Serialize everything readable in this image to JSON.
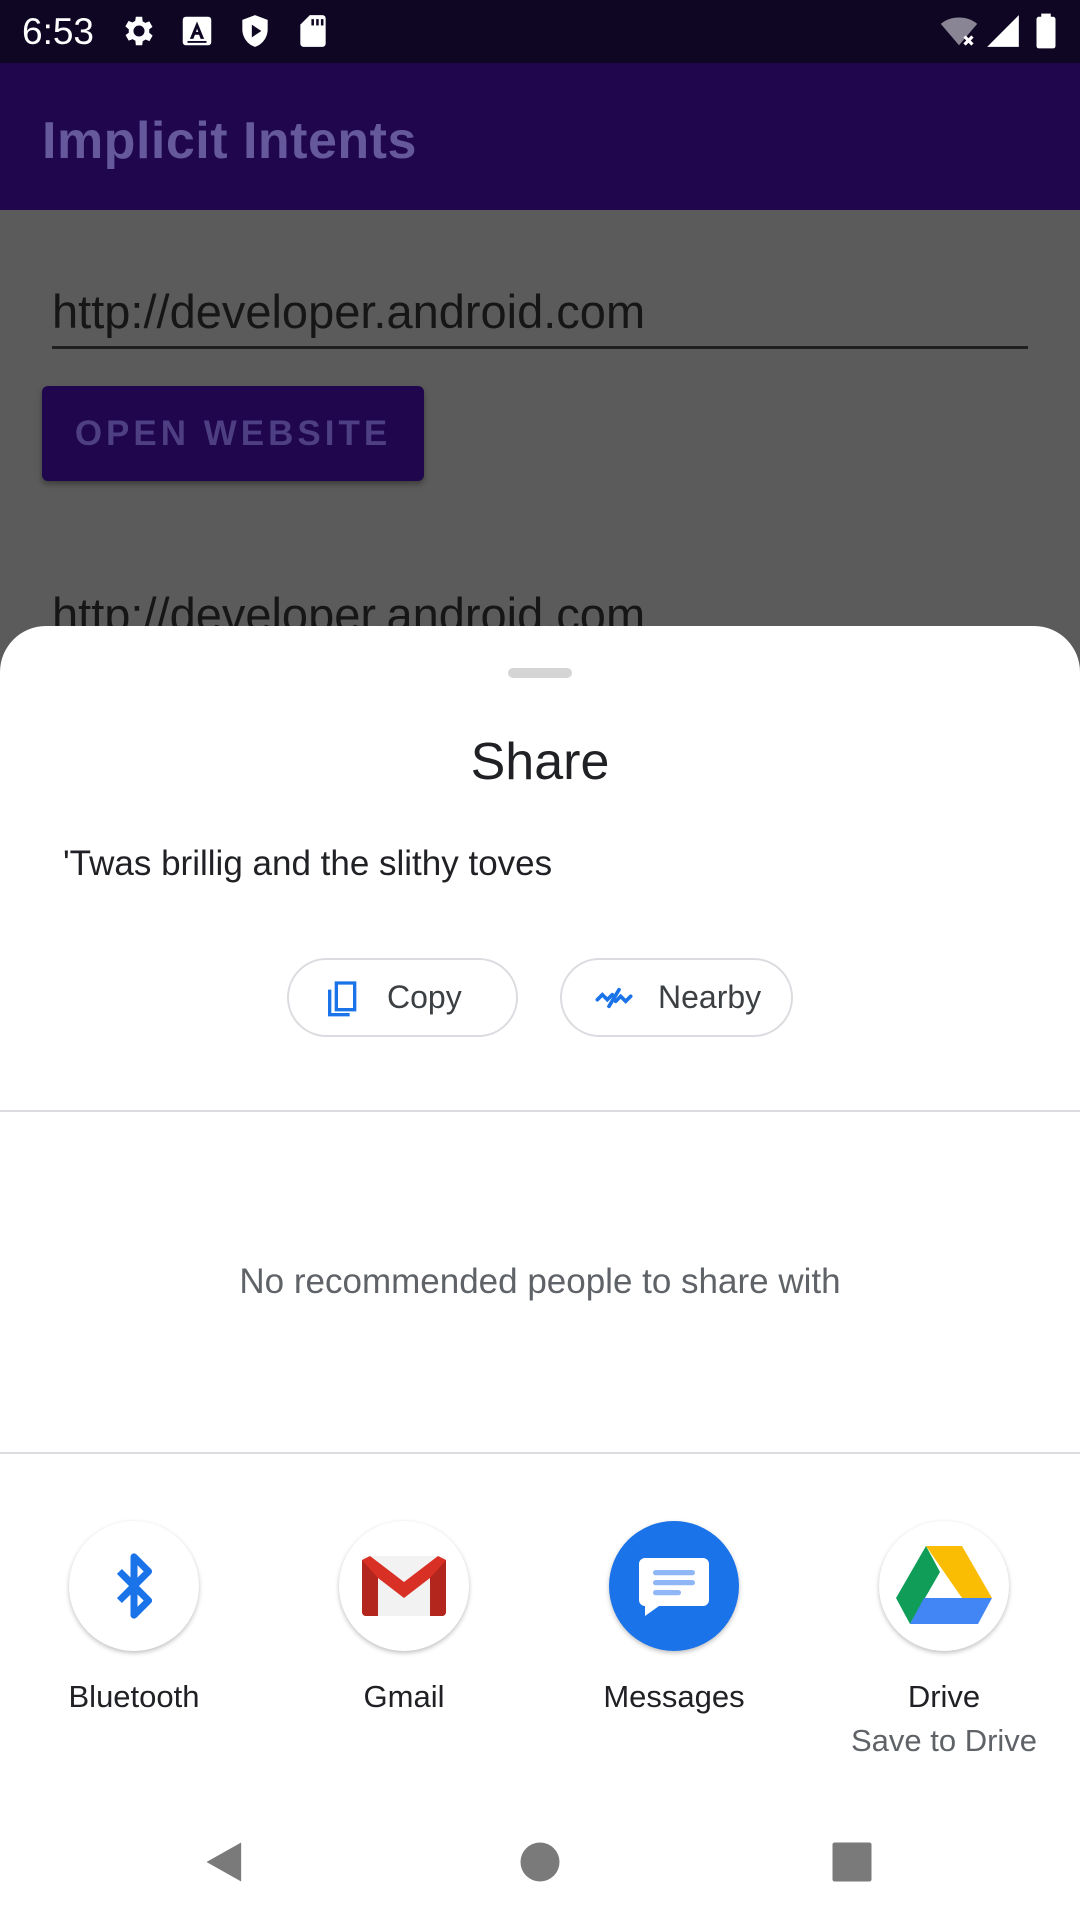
{
  "status_bar": {
    "time": "6:53",
    "left_icons": [
      "settings-icon",
      "a-box-icon",
      "shield-play-icon",
      "sd-card-icon"
    ],
    "right_icons": [
      "wifi-off-icon",
      "signal-icon",
      "battery-icon"
    ]
  },
  "app": {
    "title": "Implicit Intents",
    "url_input_value": "http://developer.android.com",
    "open_button_label": "OPEN WEBSITE",
    "second_url_text": "http://developer.android.com"
  },
  "share_sheet": {
    "title": "Share",
    "shared_text": "'Twas brillig and the slithy toves",
    "actions": [
      {
        "label": "Copy",
        "icon": "copy-icon"
      },
      {
        "label": "Nearby",
        "icon": "nearby-icon"
      }
    ],
    "no_people_message": "No recommended people to share with",
    "targets": [
      {
        "label": "Bluetooth",
        "icon": "bluetooth-icon",
        "sub": ""
      },
      {
        "label": "Gmail",
        "icon": "gmail-icon",
        "sub": ""
      },
      {
        "label": "Messages",
        "icon": "messages-icon",
        "sub": ""
      },
      {
        "label": "Drive",
        "icon": "drive-icon",
        "sub": "Save to Drive"
      }
    ]
  },
  "nav_bar": {
    "buttons": [
      "back-icon",
      "home-icon",
      "recents-icon"
    ]
  },
  "colors": {
    "accent_blue": "#1a73e8",
    "app_bar": "#1f064d",
    "scrim": "#5b5b5b"
  }
}
